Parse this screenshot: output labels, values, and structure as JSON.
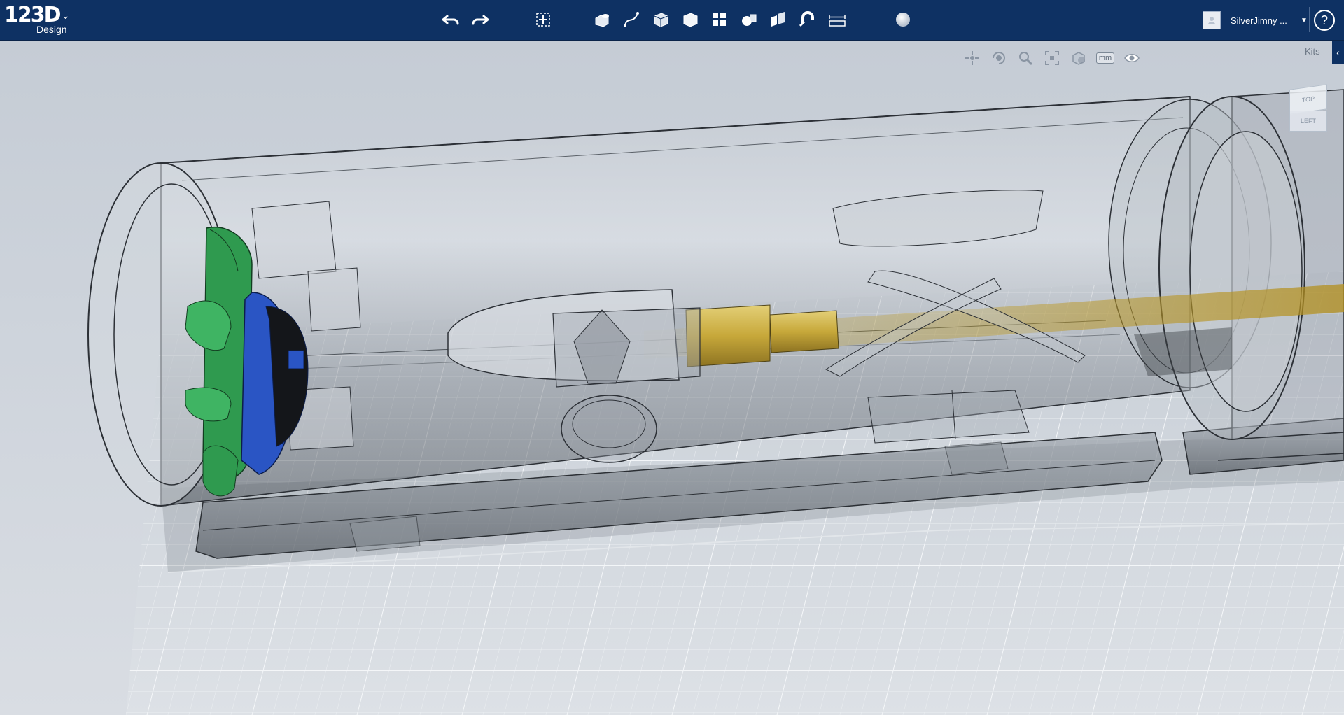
{
  "app": {
    "logo_text": "123D",
    "logo_sub": "Design",
    "logo_caret": "⌄"
  },
  "toolbar": {
    "tools": [
      {
        "name": "undo",
        "icon": "undo-icon"
      },
      {
        "name": "redo",
        "icon": "redo-icon"
      },
      {
        "name": "transform",
        "icon": "transform-icon"
      },
      {
        "name": "primitives",
        "icon": "primitives-icon"
      },
      {
        "name": "sketch",
        "icon": "sketch-icon"
      },
      {
        "name": "construct",
        "icon": "construct-icon"
      },
      {
        "name": "modify",
        "icon": "modify-icon"
      },
      {
        "name": "pattern",
        "icon": "pattern-icon"
      },
      {
        "name": "grouping",
        "icon": "grouping-icon"
      },
      {
        "name": "combine",
        "icon": "combine-icon"
      },
      {
        "name": "snap",
        "icon": "snap-magnet-icon"
      },
      {
        "name": "measure",
        "icon": "measure-icon"
      },
      {
        "name": "material",
        "icon": "material-sphere-icon"
      }
    ]
  },
  "user": {
    "name": "SilverJimny ...",
    "caret": "▼",
    "help": "?"
  },
  "viewport": {
    "nav_tools": [
      {
        "name": "pan",
        "icon": "pan-icon"
      },
      {
        "name": "orbit",
        "icon": "orbit-icon"
      },
      {
        "name": "zoom",
        "icon": "zoom-icon"
      },
      {
        "name": "fit",
        "icon": "fit-selected-icon"
      },
      {
        "name": "display-mode",
        "icon": "display-mode-icon"
      },
      {
        "name": "units",
        "icon": "units-icon",
        "label": "mm"
      },
      {
        "name": "visibility",
        "icon": "eye-icon"
      }
    ],
    "kits_label": "Kits",
    "kits_toggle": "‹",
    "viewcube": {
      "top": "TOP",
      "left": "LEFT"
    }
  },
  "colors": {
    "topbar": "#0e3163",
    "green_part": "#2f9a4f",
    "blue_part": "#2a55c4",
    "brass_part": "#c7a83a"
  }
}
